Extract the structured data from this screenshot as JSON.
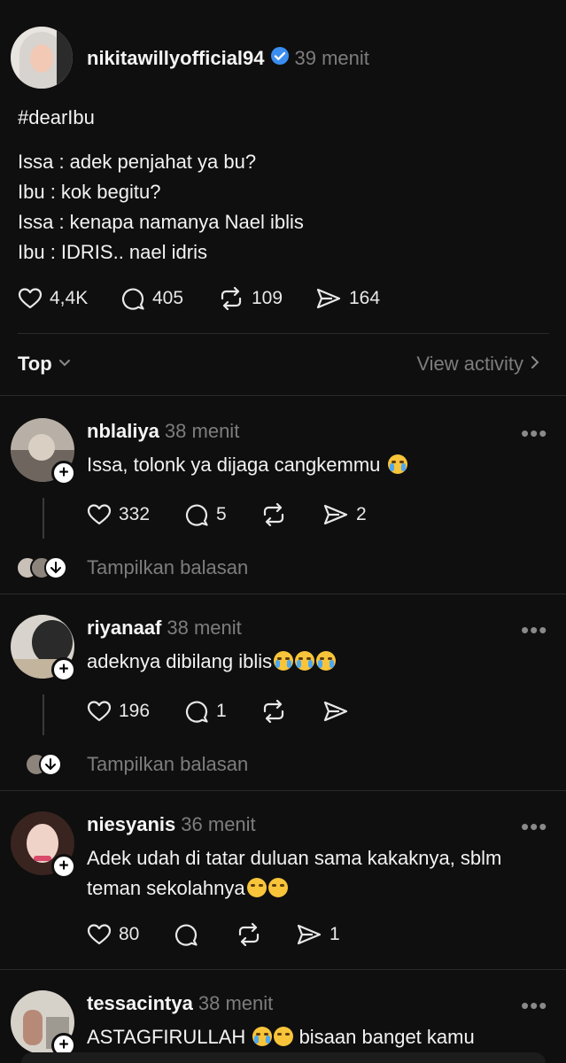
{
  "post": {
    "username": "nikitawillyofficial94",
    "time": "39 menit",
    "hashtag": "#dearIbu",
    "lines": [
      "Issa : adek penjahat ya bu?",
      "Ibu : kok begitu?",
      "Issa : kenapa namanya Nael iblis",
      "Ibu : IDRIS.. nael idris"
    ],
    "likes": "4,4K",
    "comments": "405",
    "reposts": "109",
    "shares": "164"
  },
  "sort": {
    "label": "Top",
    "activity": "View activity"
  },
  "replies": [
    {
      "username": "nblaliya",
      "time": "38 menit",
      "text": "Issa, tolonk ya dijaga cangkemmu",
      "likes": "332",
      "comments": "5",
      "reposts": "",
      "shares": "2",
      "show_replies": "Tampilkan balasan"
    },
    {
      "username": "riyanaaf",
      "time": "38 menit",
      "text": "adeknya dibilang iblis",
      "likes": "196",
      "comments": "1",
      "reposts": "",
      "shares": "",
      "show_replies": "Tampilkan balasan"
    },
    {
      "username": "niesyanis",
      "time": "36 menit",
      "text_line1": "Adek udah di tatar duluan sama kakaknya, sblm",
      "text_line2": "teman sekolahnya",
      "likes": "80",
      "comments": "",
      "reposts": "",
      "shares": "1"
    },
    {
      "username": "tessacintya",
      "time": "38 menit",
      "text": "ASTAGFIRULLAH",
      "text_after": "bisaan banget kamu"
    }
  ],
  "icons": {
    "verified": "verified-badge-icon",
    "like": "heart-icon",
    "comment": "comment-icon",
    "repost": "repost-icon",
    "share": "send-icon",
    "more": "more-dots-icon",
    "chevron_down": "chevron-down-icon",
    "chevron_right": "chevron-right-icon"
  },
  "colors": {
    "background": "#0f0f0f",
    "verified": "#3a8ef0",
    "muted": "#7d7d7d"
  }
}
